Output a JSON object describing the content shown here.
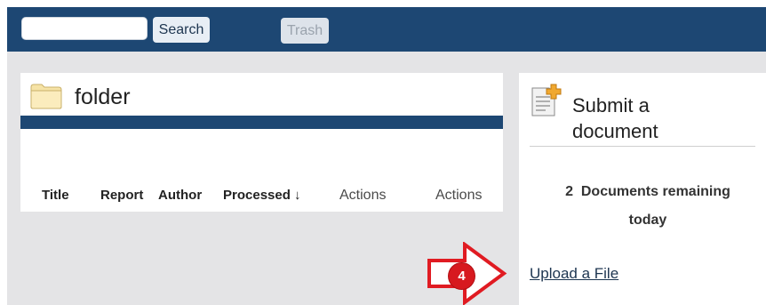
{
  "toolbar": {
    "search_placeholder": "",
    "search_value": "",
    "search_label": "Search",
    "trash_label": "Trash"
  },
  "folder": {
    "title": "folder",
    "columns": [
      "Title",
      "Report",
      "Author",
      "Processed ↓",
      "Actions",
      "Actions"
    ]
  },
  "submit": {
    "title_line1": "Submit a",
    "title_line2": "document",
    "remaining_count": "2",
    "remaining_text": "Documents remaining",
    "remaining_suffix": "today",
    "upload_label": "Upload a File"
  },
  "annotation": {
    "step_number": "4"
  },
  "colors": {
    "header_blue": "#1d4773",
    "page_gray": "#e4e4e6",
    "annotation_red": "#d7191f"
  },
  "icons": {
    "folder": "folder-icon",
    "document_add": "document-add-icon",
    "arrow": "right-arrow-icon"
  }
}
